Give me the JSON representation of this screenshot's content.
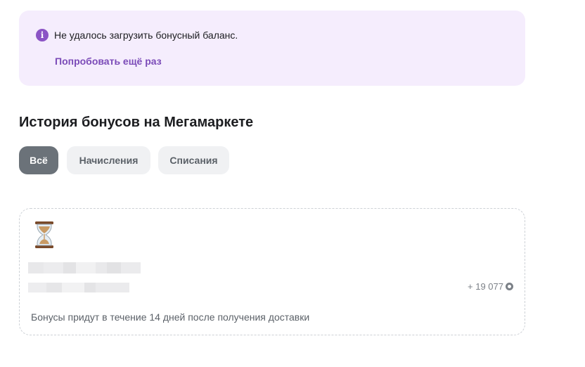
{
  "alert": {
    "message": "Не удалось загрузить бонусный баланс.",
    "retry_label": "Попробовать ещё раз",
    "icon": "info-icon",
    "color": "#8b54c5",
    "background": "#f5edfd"
  },
  "history": {
    "title": "История бонусов на Мегамаркете",
    "filters": [
      {
        "label": "Всё",
        "active": true
      },
      {
        "label": "Начисления",
        "active": false
      },
      {
        "label": "Списания",
        "active": false
      }
    ]
  },
  "card": {
    "icon": "hourglass-icon",
    "amount": "+ 19 077",
    "amount_icon": "bonus-coin-icon",
    "note": "Бонусы придут в течение 14 дней после получения доставки"
  }
}
